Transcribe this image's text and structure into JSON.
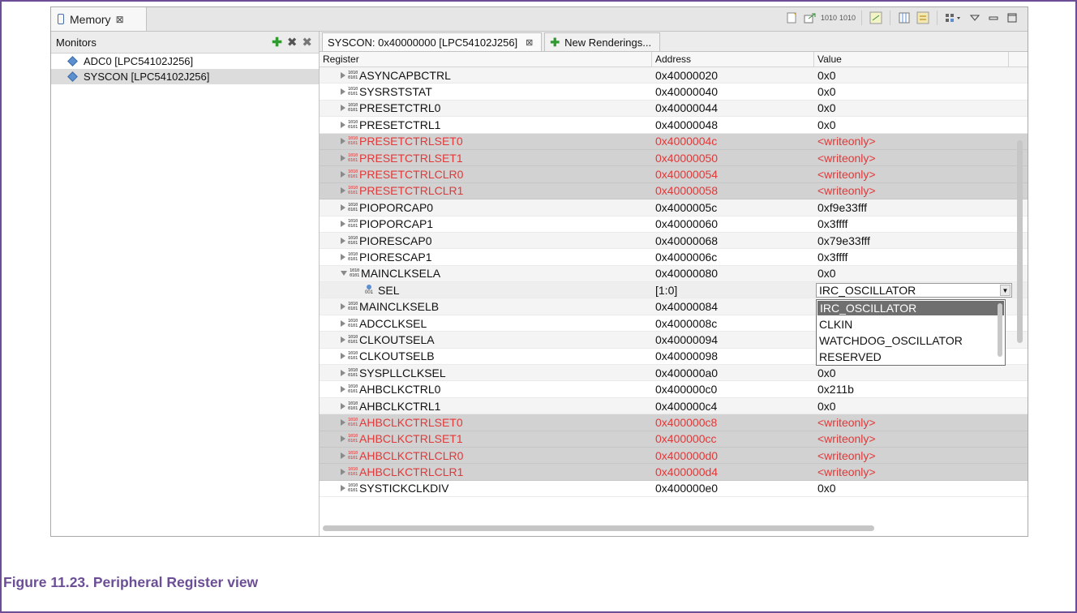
{
  "view": {
    "title": "Memory"
  },
  "monitors": {
    "header": "Monitors",
    "items": [
      {
        "label": "ADC0 [LPC54102J256]",
        "selected": false
      },
      {
        "label": "SYSCON [LPC54102J256]",
        "selected": true
      }
    ]
  },
  "rendering_tabs": [
    {
      "label": "SYSCON: 0x40000000 [LPC54102J256]",
      "active": true
    },
    {
      "label": "New Renderings...",
      "active": false
    }
  ],
  "columns": {
    "register": "Register",
    "address": "Address",
    "value": "Value"
  },
  "rows": [
    {
      "name": "ASYNCAPBCTRL",
      "address": "0x40000020",
      "value": "0x0",
      "type": "reg"
    },
    {
      "name": "SYSRSTSTAT",
      "address": "0x40000040",
      "value": "0x0",
      "type": "reg"
    },
    {
      "name": "PRESETCTRL0",
      "address": "0x40000044",
      "value": "0x0",
      "type": "reg"
    },
    {
      "name": "PRESETCTRL1",
      "address": "0x40000048",
      "value": "0x0",
      "type": "reg"
    },
    {
      "name": "PRESETCTRLSET0",
      "address": "0x4000004c",
      "value": "<writeonly>",
      "type": "wo"
    },
    {
      "name": "PRESETCTRLSET1",
      "address": "0x40000050",
      "value": "<writeonly>",
      "type": "wo"
    },
    {
      "name": "PRESETCTRLCLR0",
      "address": "0x40000054",
      "value": "<writeonly>",
      "type": "wo"
    },
    {
      "name": "PRESETCTRLCLR1",
      "address": "0x40000058",
      "value": "<writeonly>",
      "type": "wo"
    },
    {
      "name": "PIOPORCAP0",
      "address": "0x4000005c",
      "value": "0xf9e33fff",
      "type": "reg"
    },
    {
      "name": "PIOPORCAP1",
      "address": "0x40000060",
      "value": "0x3ffff",
      "type": "reg"
    },
    {
      "name": "PIORESCAP0",
      "address": "0x40000068",
      "value": "0x79e33fff",
      "type": "reg"
    },
    {
      "name": "PIORESCAP1",
      "address": "0x4000006c",
      "value": "0x3ffff",
      "type": "reg"
    },
    {
      "name": "MAINCLKSELA",
      "address": "0x40000080",
      "value": "0x0",
      "type": "expanded"
    },
    {
      "name": "SEL",
      "address": "[1:0]",
      "value": "",
      "type": "field"
    },
    {
      "name": "MAINCLKSELB",
      "address": "0x40000084",
      "value": "",
      "type": "reg"
    },
    {
      "name": "ADCCLKSEL",
      "address": "0x4000008c",
      "value": "",
      "type": "reg"
    },
    {
      "name": "CLKOUTSELA",
      "address": "0x40000094",
      "value": "",
      "type": "reg"
    },
    {
      "name": "CLKOUTSELB",
      "address": "0x40000098",
      "value": "",
      "type": "reg"
    },
    {
      "name": "SYSPLLCLKSEL",
      "address": "0x400000a0",
      "value": "0x0",
      "type": "reg"
    },
    {
      "name": "AHBCLKCTRL0",
      "address": "0x400000c0",
      "value": "0x211b",
      "type": "reg"
    },
    {
      "name": "AHBCLKCTRL1",
      "address": "0x400000c4",
      "value": "0x0",
      "type": "reg"
    },
    {
      "name": "AHBCLKCTRLSET0",
      "address": "0x400000c8",
      "value": "<writeonly>",
      "type": "wo"
    },
    {
      "name": "AHBCLKCTRLSET1",
      "address": "0x400000cc",
      "value": "<writeonly>",
      "type": "wo"
    },
    {
      "name": "AHBCLKCTRLCLR0",
      "address": "0x400000d0",
      "value": "<writeonly>",
      "type": "wo"
    },
    {
      "name": "AHBCLKCTRLCLR1",
      "address": "0x400000d4",
      "value": "<writeonly>",
      "type": "wo"
    },
    {
      "name": "SYSTICKCLKDIV",
      "address": "0x400000e0",
      "value": "0x0",
      "type": "reg"
    }
  ],
  "sel_combo": {
    "value": "IRC_OSCILLATOR",
    "options": [
      {
        "label": "IRC_OSCILLATOR",
        "highlighted": true
      },
      {
        "label": "CLKIN",
        "highlighted": false
      },
      {
        "label": "WATCHDOG_OSCILLATOR",
        "highlighted": false
      },
      {
        "label": "RESERVED",
        "highlighted": false
      }
    ]
  },
  "colors": {
    "writeonly_text": "#e23838",
    "caption": "#6b4e96",
    "add_green": "#2f9b2f"
  },
  "caption": "Figure 11.23. Peripheral Register view"
}
